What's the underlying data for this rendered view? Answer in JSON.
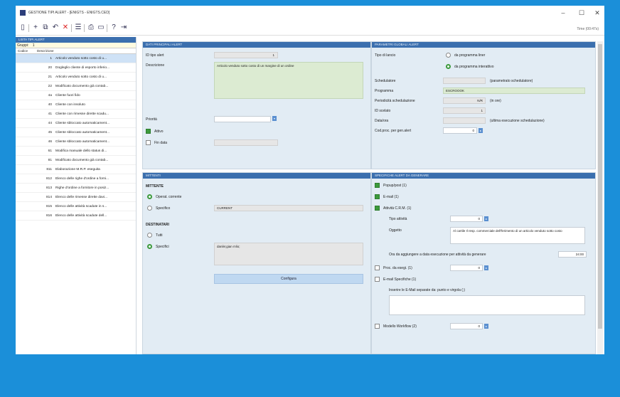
{
  "window": {
    "title": "GESTIONE TIPI ALERT - [ENIGTS - ENIGTS.CED]",
    "minimize": "–",
    "maximize": "☐",
    "close": "✕",
    "time": "Time (00:47s)"
  },
  "left": {
    "panel_title": "LISTA TIPI ALERT",
    "group_label": "Gruppi:",
    "group_value": "1",
    "col_code": "Codice",
    "col_desc": "Descrizione",
    "rows": [
      {
        "code": "1",
        "desc": "Articolo venduto sotto costo di u..."
      },
      {
        "code": "20",
        "desc": "Dogleglio cliente di esporto inferio..."
      },
      {
        "code": "21",
        "desc": "Articolo venduto sotto costo di u..."
      },
      {
        "code": "22",
        "desc": "Modificato documento già contab..."
      },
      {
        "code": "4a",
        "desc": "Cliente fuori fido"
      },
      {
        "code": "40",
        "desc": "Cliente con insoluto"
      },
      {
        "code": "41",
        "desc": "Cliente con rimesse dirette scadu..."
      },
      {
        "code": "44",
        "desc": "Cliente sbloccato automaticament..."
      },
      {
        "code": "45",
        "desc": "Cliente sbloccato automaticament..."
      },
      {
        "code": "46",
        "desc": "Cliente sbloccato automaticament..."
      },
      {
        "code": "61",
        "desc": "Modifica manuale dello status di..."
      },
      {
        "code": "81",
        "desc": "Modificato documento già contab..."
      },
      {
        "code": "811",
        "desc": "Elaborazione M.R.P. eseguita"
      },
      {
        "code": "812",
        "desc": "Elenco delle righe d'ordine a forni..."
      },
      {
        "code": "813",
        "desc": "Righe d'ordine a fornitore in posiz..."
      },
      {
        "code": "814",
        "desc": "Elenco delle rimesse dirette davi..."
      },
      {
        "code": "815",
        "desc": "Elenco delle attività scadute in s..."
      },
      {
        "code": "816",
        "desc": "Elenco delle attività scadute dell..."
      }
    ]
  },
  "dati": {
    "title": "DATI PRINCIPALI ALERT",
    "tipo_label": "ID tipo alert",
    "tipo_value": "1",
    "desc_label": "Descrizione",
    "desc_value": "Articolo venduto sotto costo di un margine di un ordine",
    "priorita_label": "Priorità",
    "attivo_label": "Attivo",
    "data_label": "Fin data"
  },
  "mittenti": {
    "title": "MITTENTI",
    "mittente_head": "MITTENTE",
    "operat_label": "Operat. corrente",
    "specifico_label": "Specifico",
    "specifico_value": "CURRENT",
    "dest_head": "DESTINATARI",
    "tutti_label": "Tutti",
    "spec2_label": "Specifici",
    "spec2_value": "danile;gian mlio;",
    "configura": "Configura"
  },
  "param": {
    "title": "PARAMETRI GLOBALI ALERT",
    "tipo_label": "Tipo di lancio",
    "opt1": "da programma liner",
    "opt2": "da programma interattivo",
    "schedulatore_label": "Schedulatore",
    "schedulatore_hint": "(parametrato schedulatore)",
    "programma_label": "Programma",
    "programma_value": "ESCROOOK",
    "period_label": "Periodicità schedulazione",
    "period_value": "N/R",
    "period_unit": "(in ore)",
    "id_label": "ID scelato",
    "id_value": "1",
    "datalav_label": "Data/ora",
    "datalav_hint": "(ultima esecuzione schedulazione)",
    "cod_label": "Cod.proc. per gen.alert",
    "cod_value": "0"
  },
  "spec": {
    "title": "SPECIFICHE ALERT DA GENERARE",
    "popup": "Popup/post (1)",
    "email": "E-mail (1)",
    "attivita": "Attività C.R.M. (1)",
    "tipo_att_label": "Tipo attività",
    "tipo_att_value": "0",
    "oggetto_label": "Oggetto",
    "oggetto_value": "Al cartile Il resp. commerciale dell'ferimento di un articolo venduto sotto costo",
    "giorni_label": "Ora da aggiungere a data esecuzione per attività da generare",
    "giorni_value": "24:00",
    "proc_label": "Proc. da esegi. (1)",
    "proc_value": "0",
    "emailspec_label": "E-mail Specifiche (1)",
    "emailspec_hint": "Inserire le E-Mail separate da: punto e virgola (;)",
    "modello_label": "Modello Workflow (2)",
    "modello_value": "0"
  }
}
